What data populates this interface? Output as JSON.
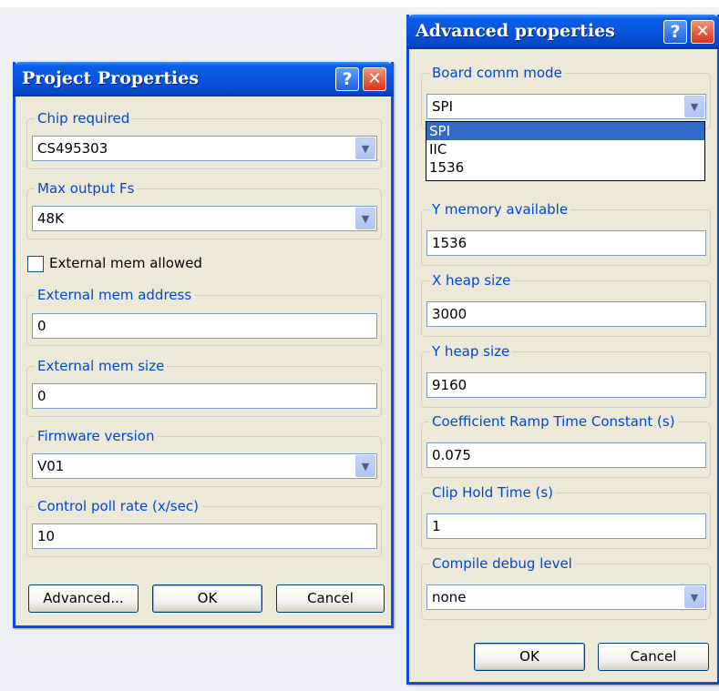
{
  "project_dialog": {
    "title": "Project Properties",
    "help_glyph": "?",
    "close_glyph": "✕",
    "chip_required": {
      "label": "Chip required",
      "value": "CS495303"
    },
    "max_output_fs": {
      "label": "Max output Fs",
      "value": "48K"
    },
    "external_mem_allowed": {
      "label": "External mem allowed",
      "checked": false
    },
    "external_mem_address": {
      "label": "External mem address",
      "value": "0"
    },
    "external_mem_size": {
      "label": "External mem size",
      "value": "0"
    },
    "firmware_version": {
      "label": "Firmware version",
      "value": "V01"
    },
    "control_poll_rate": {
      "label": "Control poll rate (x/sec)",
      "value": "10"
    },
    "buttons": {
      "advanced": "Advanced...",
      "ok": "OK",
      "cancel": "Cancel"
    }
  },
  "advanced_dialog": {
    "title": "Advanced properties",
    "help_glyph": "?",
    "close_glyph": "✕",
    "board_comm_mode": {
      "label": "Board comm mode",
      "value": "SPI",
      "options": [
        "SPI",
        "IIC",
        "1536"
      ]
    },
    "y_memory_available": {
      "label": "Y memory available",
      "value": "1536"
    },
    "x_heap_size": {
      "label": "X heap size",
      "value": "3000"
    },
    "y_heap_size": {
      "label": "Y heap size",
      "value": "9160"
    },
    "coefficient_ramp_time_constant": {
      "label": "Coefficient Ramp Time Constant (s)",
      "value": "0.075"
    },
    "clip_hold_time": {
      "label": "Clip Hold Time (s)",
      "value": "1"
    },
    "compile_debug_level": {
      "label": "Compile debug level",
      "value": "none"
    },
    "buttons": {
      "ok": "OK",
      "cancel": "Cancel"
    }
  },
  "icons": {
    "combo_arrow": "chevron-down-icon",
    "help": "question-icon",
    "close": "close-icon"
  },
  "colors": {
    "titlebar": "#0a55de",
    "group_label": "#0046d5",
    "dialog_bg": "#ece9d8",
    "selection": "#316ac5"
  }
}
